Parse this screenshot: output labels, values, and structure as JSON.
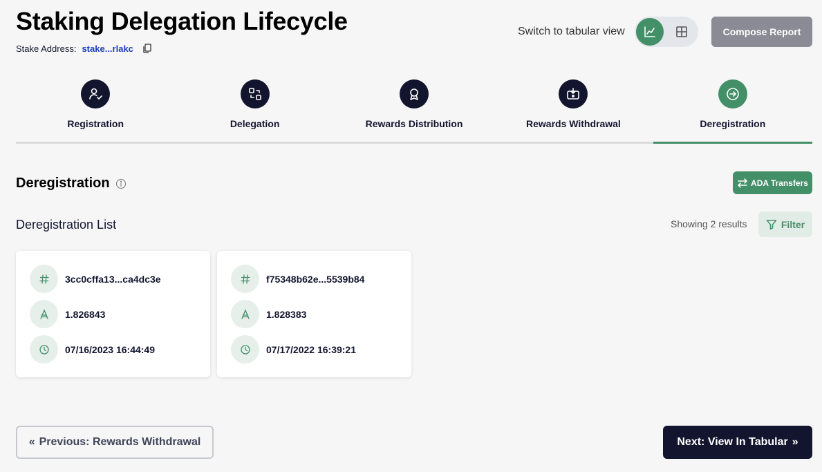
{
  "header": {
    "title": "Staking Delegation Lifecycle",
    "stake_label": "Stake Address:",
    "stake_address": "stake...rlakc",
    "switch_label": "Switch to tabular view",
    "compose_label": "Compose Report"
  },
  "steps": [
    {
      "label": "Registration",
      "icon": "user-check-icon"
    },
    {
      "label": "Delegation",
      "icon": "delegation-icon"
    },
    {
      "label": "Rewards Distribution",
      "icon": "award-icon"
    },
    {
      "label": "Rewards Withdrawal",
      "icon": "wallet-withdraw-icon"
    },
    {
      "label": "Deregistration",
      "icon": "sign-out-icon",
      "active": true
    }
  ],
  "section": {
    "title": "Deregistration",
    "ada_transfers_label": "ADA Transfers",
    "list_title": "Deregistration List",
    "results_text": "Showing 2 results",
    "filter_label": "Filter"
  },
  "cards": [
    {
      "hash": "3cc0cffa13...ca4dc3e",
      "amount": "1.826843",
      "time": "07/16/2023 16:44:49"
    },
    {
      "hash": "f75348b62e...5539b84",
      "amount": "1.828383",
      "time": "07/17/2022 16:39:21"
    }
  ],
  "nav": {
    "prev_label": "Previous: Rewards Withdrawal",
    "next_label": "Next: View In Tabular"
  },
  "colors": {
    "accent": "#438f68",
    "dark": "#13152f",
    "link": "#1e3fbf"
  }
}
